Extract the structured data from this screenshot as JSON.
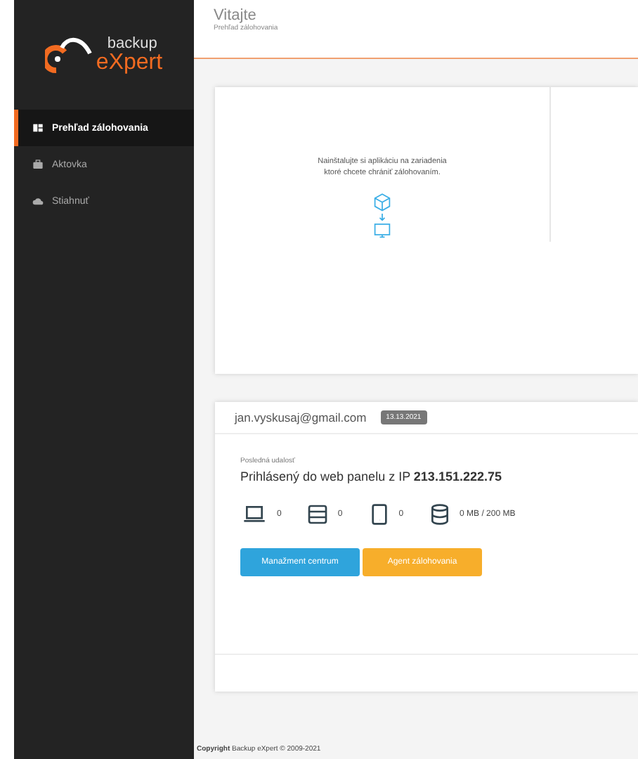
{
  "logo": {
    "top": "backup",
    "bottom": "eXpert"
  },
  "sidebar": {
    "items": [
      {
        "label": "Prehľad zálohovania",
        "kind": "dashboard",
        "selected": true
      },
      {
        "label": "Aktovka",
        "kind": "briefcase",
        "selected": false
      },
      {
        "label": "Stiahnuť",
        "kind": "cloud",
        "selected": false
      }
    ]
  },
  "header": {
    "title": "Vitajte",
    "subtitle": "Prehľad zálohovania"
  },
  "install_card": {
    "text": "Nainštalujte si aplikáciu na zariadenia ktoré chcete chrániť zálohovaním."
  },
  "account_card": {
    "email": "jan.vyskusaj@gmail.com",
    "date": "13.13.2021",
    "event_label": "Posledná udalosť",
    "event_text": "Prihlásený do web panelu z IP **213.151.222.75**",
    "stats": [
      {
        "kind": "laptop",
        "value": "0"
      },
      {
        "kind": "server",
        "value": "0"
      },
      {
        "kind": "tablet",
        "value": "0"
      },
      {
        "kind": "database",
        "value": "0 MB / 200 MB"
      }
    ],
    "buttons": [
      {
        "label": "Manažment centrum",
        "kind": "primary"
      },
      {
        "label": "Agent zálohovania",
        "kind": "warning"
      }
    ]
  },
  "footer": "**Copyright** Backup eXpert © 2009-2021"
}
